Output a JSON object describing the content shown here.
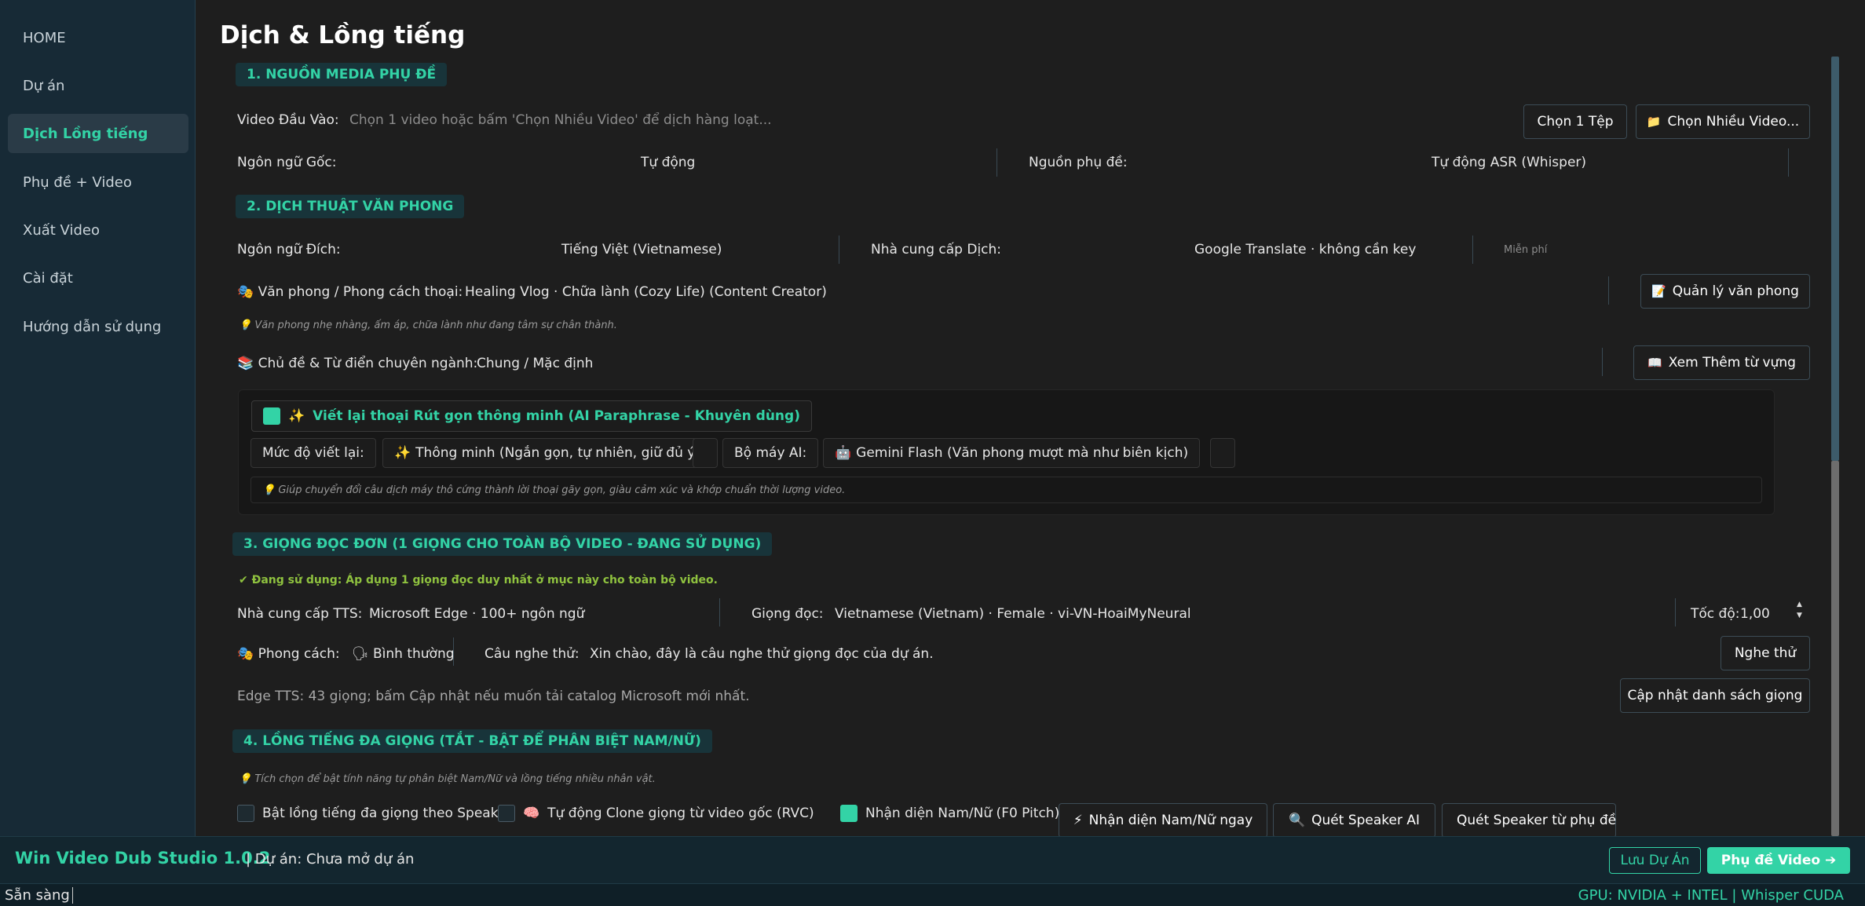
{
  "sidebar": {
    "items": [
      {
        "label": "HOME"
      },
      {
        "label": "Dự án"
      },
      {
        "label": "Dịch  Lồng tiếng",
        "active": true
      },
      {
        "label": "Phụ đề + Video"
      },
      {
        "label": "Xuất Video"
      },
      {
        "label": "Cài đặt"
      },
      {
        "label": "Hướng dẫn sử dụng"
      }
    ]
  },
  "page": {
    "title": "Dịch & Lồng tiếng"
  },
  "s1": {
    "heading": "1. NGUỒN MEDIA  PHỤ ĐỀ",
    "input_label": "Video Đầu Vào:",
    "input_placeholder": "Chọn 1 video hoặc bấm 'Chọn Nhiều Video' để dịch hàng loạt...",
    "btn_choose_one": "Chọn 1 Tệp",
    "btn_choose_many": "Chọn Nhiều Video...",
    "src_lang_label": "Ngôn ngữ Gốc:",
    "src_lang_value": "Tự động",
    "sub_source_label": "Nguồn phụ đề:",
    "sub_source_value": "Tự động ASR (Whisper)"
  },
  "s2": {
    "heading": "2. DỊCH THUẬT  VĂN PHONG",
    "target_label": "Ngôn ngữ Đích:",
    "target_value": "Tiếng Việt (Vietnamese)",
    "provider_label": "Nhà cung cấp Dịch:",
    "provider_value": "Google Translate · không cần key",
    "provider_note": "Miễn phí",
    "style_label": "Văn phong / Phong cách thoại:",
    "style_value": "Healing Vlog · Chữa lành (Cozy Life) (Content Creator)",
    "btn_style_manage": "Quản lý văn phong",
    "style_hint": "Văn phong nhẹ nhàng, ấm áp, chữa lành như đang tâm sự chân thành.",
    "topic_label": "Chủ đề & Từ điển chuyên ngành:",
    "topic_value": "Chung / Mặc định",
    "btn_vocab": "Xem  Thêm từ vựng",
    "ai": {
      "checkbox_label": "Viết lại thoại  Rút gọn thông minh (AI Paraphrase - Khuyên dùng)",
      "level_label": "Mức độ viết lại:",
      "level_value": "Thông minh (Ngắn gọn, tự nhiên, giữ đủ ý)",
      "engine_label": "Bộ máy AI:",
      "engine_value": "Gemini Flash (Văn phong mượt mà như biên kịch)",
      "hint": "Giúp chuyển đổi câu dịch máy thô cứng thành lời thoại gãy gọn, giàu cảm xúc và khớp chuẩn thời lượng video."
    }
  },
  "s3": {
    "heading": "3. GIỌNG ĐỌC ĐƠN (1 GIỌNG CHO TOÀN BỘ VIDEO - ĐANG SỬ DỤNG)",
    "active_note": "✔ Đang sử dụng: Áp dụng 1 giọng đọc duy nhất ở mục này cho toàn bộ video.",
    "tts_label": "Nhà cung cấp TTS:",
    "tts_value": "Microsoft Edge · 100+ ngôn ngữ",
    "voice_label": "Giọng đọc:",
    "voice_value": "Vietnamese (Vietnam) · Female · vi-VN-HoaiMyNeural",
    "speed_label": "Tốc độ:",
    "speed_value": "1,00",
    "tone_label": "Phong cách:",
    "tone_value": "Bình thường",
    "sample_label": "Câu nghe thử:",
    "sample_value": "Xin chào, đây là câu nghe thử giọng đọc của dự án.",
    "btn_listen": "Nghe thử",
    "info": "Edge TTS: 43 giọng; bấm Cập nhật nếu muốn tải catalog Microsoft mới nhất.",
    "btn_update": "Cập nhật danh sách giọng"
  },
  "s4": {
    "heading": "4. LỒNG TIẾNG ĐA GIỌNG (TẮT - BẬT ĐỂ PHÂN BIỆT NAM/NỮ)",
    "hint": "Tích chọn để bật tính năng tự phân biệt Nam/Nữ và lồng tiếng nhiều nhân vật.",
    "opt1": "Bật lồng tiếng đa giọng theo Speaker",
    "opt2": "Tự động Clone giọng từ video gốc (RVC)",
    "opt3": "Nhận diện Nam/Nữ (F0 Pitch)",
    "btn1": "Nhận diện Nam/Nữ ngay",
    "btn2": "Quét Speaker AI",
    "btn3": "Quét Speaker từ phụ đề"
  },
  "footer": {
    "brand": "Win Video Dub Studio 1.0.2",
    "project": "|  Dự án: Chưa mở dự án",
    "btn_save": "Lưu Dự Án",
    "btn_next": "Phụ đề  Video ➔"
  },
  "status": {
    "left": "Sẵn sàng",
    "right": "GPU: NVIDIA + INTEL | Whisper CUDA"
  },
  "colors": {
    "accent": "#33d3a6",
    "sidebar": "#172a36",
    "bg": "#1e1e1e"
  }
}
